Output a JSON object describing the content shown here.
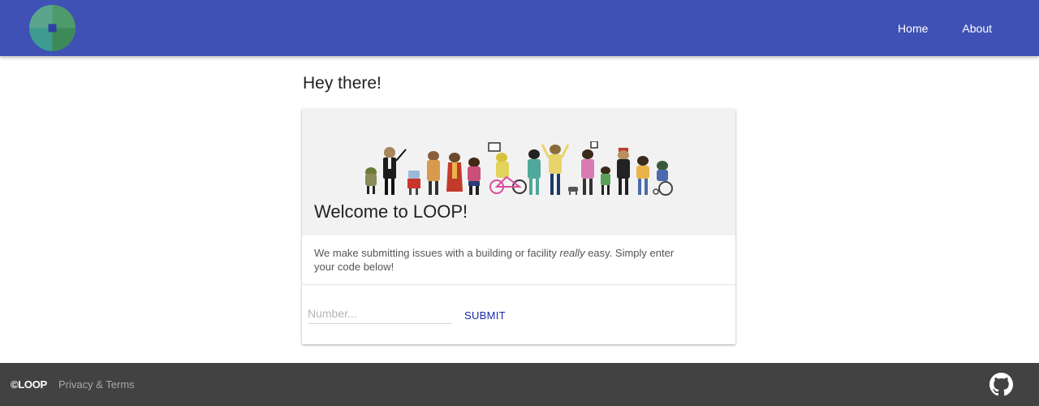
{
  "header": {
    "logo_icon": "loop-logo-icon",
    "nav": [
      {
        "label": "Home"
      },
      {
        "label": "About"
      }
    ],
    "bar_color": "#3f51b5"
  },
  "main": {
    "greeting": "Hey there!",
    "card": {
      "illustration": "android-characters-illustration",
      "title": "Welcome to LOOP!",
      "text_before": "We make submitting issues with a building or facility ",
      "text_emphasis": "really",
      "text_after": " easy. Simply enter your code below!",
      "input_placeholder": "Number...",
      "submit_label": "SUBMIT"
    }
  },
  "footer": {
    "copyright": "©LOOP",
    "privacy_link": "Privacy & Terms",
    "github_icon": "github-icon"
  }
}
